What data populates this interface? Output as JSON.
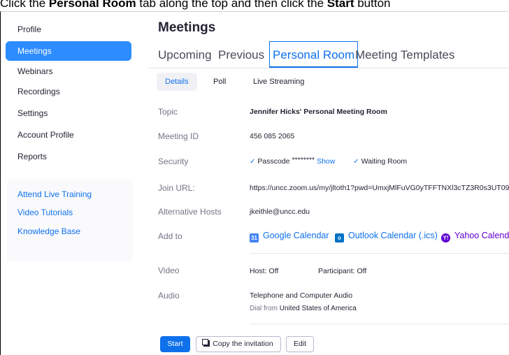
{
  "instruction": {
    "pre": "Click the ",
    "tab_name": "Personal Room",
    "mid": " tab along the top and then click the ",
    "button_name": "Start",
    "post": " button"
  },
  "sidebar": {
    "items": [
      {
        "label": "Profile"
      },
      {
        "label": "Meetings"
      },
      {
        "label": "Webinars"
      },
      {
        "label": "Recordings"
      },
      {
        "label": "Settings"
      },
      {
        "label": "Account Profile"
      },
      {
        "label": "Reports"
      }
    ],
    "links": [
      {
        "label": "Attend Live Training"
      },
      {
        "label": "Video Tutorials"
      },
      {
        "label": "Knowledge Base"
      }
    ]
  },
  "page_title": "Meetings",
  "tabs": [
    {
      "label": "Upcoming"
    },
    {
      "label": "Previous"
    },
    {
      "label": "Personal Room"
    },
    {
      "label": "Meeting Templates"
    }
  ],
  "subtabs": [
    {
      "label": "Details"
    },
    {
      "label": "Poll"
    },
    {
      "label": "Live Streaming"
    }
  ],
  "fields": {
    "topic": {
      "label": "Topic",
      "value": "Jennifer Hicks' Personal Meeting Room"
    },
    "meeting_id": {
      "label": "Meeting ID",
      "value": "456 085 2065"
    },
    "security": {
      "label": "Security",
      "passcode_label": "Passcode",
      "passcode_mask": "********",
      "show_link": "Show",
      "waiting_room": "Waiting Room"
    },
    "join_url": {
      "label": "Join URL:",
      "value": "https://uncc.zoom.us/my/jltoth1?pwd=UmxjMlFuVG0yTFFTNXl3cTZ3R0s3UT09"
    },
    "alt_hosts": {
      "label": "Alternative Hosts",
      "value": "jkeithle@uncc.edu"
    },
    "add_to": {
      "label": "Add to",
      "google": "Google Calendar",
      "google_icon": "31",
      "outlook": "Outlook Calendar (.ics)",
      "outlook_icon": "o",
      "yahoo": "Yahoo Calendar",
      "yahoo_icon": "Y!"
    },
    "video": {
      "label": "Video",
      "host": "Host: Off",
      "participant": "Participant: Off"
    },
    "audio": {
      "label": "Audio",
      "value": "Telephone and Computer Audio",
      "dial_prefix": "Dial from",
      "dial_country": "United States of America"
    }
  },
  "buttons": {
    "start": "Start",
    "copy": "Copy the invitation",
    "edit": "Edit"
  },
  "colors": {
    "accent": "#0e71eb",
    "active_nav": "#2d8cff",
    "yahoo": "#6001d2"
  }
}
